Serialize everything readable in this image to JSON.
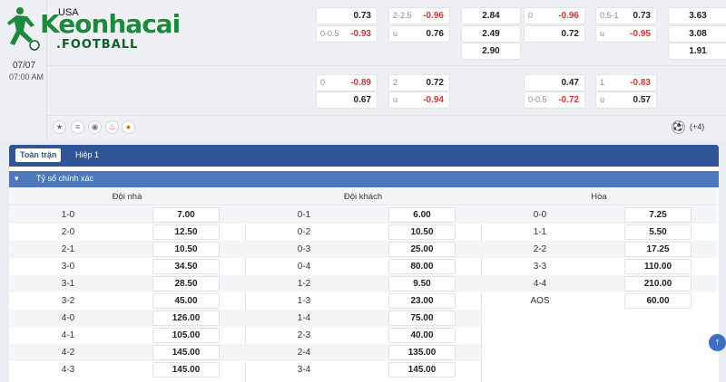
{
  "logo": {
    "text": "Keonhacai",
    "sub": ".FOOTBALL"
  },
  "match": {
    "league": "USA",
    "date": "07/07",
    "time": "07:00 AM",
    "more_count": "(+4)"
  },
  "top_odds": [
    {
      "label": "",
      "value": "0.73",
      "neg": false
    },
    {
      "label": "2-2.5",
      "value": "-0.96",
      "neg": true
    },
    {
      "label": "",
      "value": "2.84",
      "neg": false
    },
    {
      "label": "0",
      "value": "-0.96",
      "neg": true
    },
    {
      "label": "0.5-1",
      "value": "0.73",
      "neg": false
    },
    {
      "label": "",
      "value": "3.63",
      "neg": false
    },
    {
      "label": "0-0.5",
      "value": "-0.93",
      "neg": true
    },
    {
      "label": "u",
      "value": "0.76",
      "neg": false
    },
    {
      "label": "",
      "value": "2.49",
      "neg": false
    },
    {
      "label": "",
      "value": "0.72",
      "neg": false
    },
    {
      "label": "u",
      "value": "-0.95",
      "neg": true
    },
    {
      "label": "",
      "value": "3.08",
      "neg": false
    },
    {
      "label": "",
      "value": "2.90",
      "neg": false
    },
    {
      "label": "",
      "value": "1.91",
      "neg": false
    },
    {
      "label": "0",
      "value": "-0.89",
      "neg": true
    },
    {
      "label": "2",
      "value": "0.72",
      "neg": false
    },
    {
      "label": "",
      "value": "0.47",
      "neg": false
    },
    {
      "label": "1",
      "value": "-0.83",
      "neg": true
    },
    {
      "label": "",
      "value": "0.67",
      "neg": false
    },
    {
      "label": "u",
      "value": "-0.94",
      "neg": true
    },
    {
      "label": "0-0.5",
      "value": "-0.72",
      "neg": true
    },
    {
      "label": "u",
      "value": "0.57",
      "neg": false
    }
  ],
  "tabs": [
    "Toàn trận",
    "Hiệp 1"
  ],
  "section_title": "Tỷ số chính xác",
  "columns": [
    {
      "header": "Đội nhà",
      "rows": [
        {
          "score": "1-0",
          "odd": "7.00"
        },
        {
          "score": "2-0",
          "odd": "12.50"
        },
        {
          "score": "2-1",
          "odd": "10.50"
        },
        {
          "score": "3-0",
          "odd": "34.50"
        },
        {
          "score": "3-1",
          "odd": "28.50"
        },
        {
          "score": "3-2",
          "odd": "45.00"
        },
        {
          "score": "4-0",
          "odd": "126.00"
        },
        {
          "score": "4-1",
          "odd": "105.00"
        },
        {
          "score": "4-2",
          "odd": "145.00"
        },
        {
          "score": "4-3",
          "odd": "145.00"
        }
      ]
    },
    {
      "header": "Đội khách",
      "rows": [
        {
          "score": "0-1",
          "odd": "6.00"
        },
        {
          "score": "0-2",
          "odd": "10.50"
        },
        {
          "score": "0-3",
          "odd": "25.00"
        },
        {
          "score": "0-4",
          "odd": "80.00"
        },
        {
          "score": "1-2",
          "odd": "9.50"
        },
        {
          "score": "1-3",
          "odd": "23.00"
        },
        {
          "score": "1-4",
          "odd": "75.00"
        },
        {
          "score": "2-3",
          "odd": "40.00"
        },
        {
          "score": "2-4",
          "odd": "135.00"
        },
        {
          "score": "3-4",
          "odd": "145.00"
        }
      ]
    },
    {
      "header": "Hòa",
      "rows": [
        {
          "score": "0-0",
          "odd": "7.25"
        },
        {
          "score": "1-1",
          "odd": "5.50"
        },
        {
          "score": "2-2",
          "odd": "17.25"
        },
        {
          "score": "3-3",
          "odd": "110.00"
        },
        {
          "score": "4-4",
          "odd": "210.00"
        },
        {
          "score": "AOS",
          "odd": "60.00"
        }
      ]
    }
  ],
  "colors": {
    "accent": "#2f5597",
    "section": "#4d78be",
    "negative": "#d03535",
    "brand": "#1a8a3c"
  }
}
